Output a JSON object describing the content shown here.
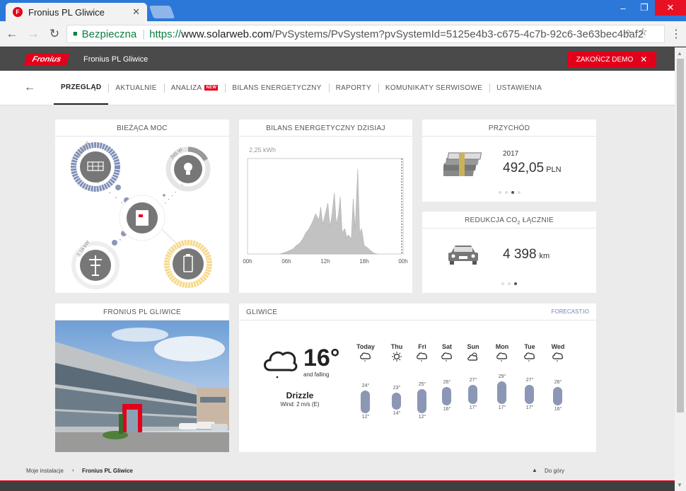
{
  "browser": {
    "tab_title": "Fronius PL Gliwice",
    "secure_label": "Bezpieczna",
    "url_prefix": "https://",
    "url_domain": "www.solarweb.com",
    "url_path": "/PvSystems/PvSystem?pvSystemId=5125e4b3-c675-4c7b-92c6-3e63bec4baf2"
  },
  "header": {
    "logo_text": "Fronius",
    "system_name": "Fronius PL Gliwice",
    "demo_button": "ZAKOŃCZ DEMO"
  },
  "nav": {
    "items": [
      "PRZEGLĄD",
      "AKTUALNIE",
      "ANALIZA",
      "BILANS ENERGETYCZNY",
      "RAPORTY",
      "KOMUNIKATY SERWISOWE",
      "USTAWIENIA"
    ],
    "new_badge": "NEW"
  },
  "power": {
    "title": "BIEŻĄCA MOC",
    "pv_label": "3,60 kW",
    "load_label": "345 W",
    "grid_label": "3,18 kW"
  },
  "energy": {
    "title": "BILANS ENERGETYCZNY DZISIAJ",
    "ymax_label": "2,25 kWh",
    "xticks": [
      "00h",
      "06h",
      "12h",
      "18h",
      "00h"
    ]
  },
  "chart_data": {
    "type": "area",
    "title": "BILANS ENERGETYCZNY DZISIAJ",
    "xlabel": "",
    "ylabel": "",
    "ylim": [
      0,
      2.25
    ],
    "x": [
      5.0,
      6.0,
      7.0,
      7.5,
      8.0,
      8.5,
      9.0,
      9.5,
      10.0,
      10.5,
      11.0,
      11.3,
      11.6,
      12.0,
      12.4,
      12.7,
      13.0,
      13.4,
      13.7,
      14.0,
      14.3,
      14.6,
      15.0,
      15.3,
      15.6,
      16.0,
      16.3,
      16.6,
      17.0,
      17.3,
      17.6,
      18.0,
      18.5,
      19.0,
      19.5,
      20.0
    ],
    "series": [
      {
        "values": [
          0,
          0.05,
          0.12,
          0.2,
          0.25,
          0.35,
          0.5,
          0.6,
          0.75,
          0.95,
          0.8,
          1.1,
          0.7,
          0.95,
          1.2,
          0.65,
          0.9,
          1.45,
          0.7,
          0.9,
          1.35,
          0.5,
          0.6,
          0.4,
          0.45,
          0.35,
          1.3,
          0.6,
          2.0,
          0.5,
          0.6,
          0.2,
          0.15,
          0.08,
          0.02,
          0
        ]
      }
    ]
  },
  "yield": {
    "title": "PRZYCHÓD",
    "year": "2017",
    "value": "492,05",
    "unit": "PLN"
  },
  "co2": {
    "title_main": "REDUKCJA CO",
    "title_sub": "2",
    "title_end": " ŁĄCZNIE",
    "value": "4 398",
    "unit": "km"
  },
  "system": {
    "title": "FRONIUS PL GLIWICE"
  },
  "weather": {
    "title": "GLIWICE",
    "link": "FORECAST.IO",
    "temp": "16°",
    "trend": "and falling",
    "summary": "Drizzle",
    "wind": "Wind: 2 m/s (E)",
    "days": [
      {
        "day": "Today",
        "hi": "24°",
        "lo": "12°",
        "icon": "drizzle-icon",
        "hi_n": 24,
        "lo_n": 12
      },
      {
        "day": "Thu",
        "hi": "23°",
        "lo": "14°",
        "icon": "sun-icon",
        "hi_n": 23,
        "lo_n": 14
      },
      {
        "day": "Fri",
        "hi": "25°",
        "lo": "12°",
        "icon": "drizzle-icon",
        "hi_n": 25,
        "lo_n": 12
      },
      {
        "day": "Sat",
        "hi": "26°",
        "lo": "16°",
        "icon": "drizzle-icon",
        "hi_n": 26,
        "lo_n": 16
      },
      {
        "day": "Sun",
        "hi": "27°",
        "lo": "17°",
        "icon": "partly-cloudy-icon",
        "hi_n": 27,
        "lo_n": 17
      },
      {
        "day": "Mon",
        "hi": "29°",
        "lo": "17°",
        "icon": "drizzle-icon",
        "hi_n": 29,
        "lo_n": 17
      },
      {
        "day": "Tue",
        "hi": "27°",
        "lo": "17°",
        "icon": "drizzle-icon",
        "hi_n": 27,
        "lo_n": 17
      },
      {
        "day": "Wed",
        "hi": "26°",
        "lo": "16°",
        "icon": "drizzle-icon",
        "hi_n": 26,
        "lo_n": 16
      }
    ]
  },
  "footer": {
    "crumb_root": "Moje instalacje",
    "crumb_current": "Fronius PL Gliwice",
    "to_top": "Do góry"
  },
  "colors": {
    "brand": "#e2001a",
    "pv_ring": "#7f8fb8",
    "battery_ring": "#f7d98a",
    "chart_fill": "#c2c2c2",
    "weather_bar": "#8c97b6"
  }
}
